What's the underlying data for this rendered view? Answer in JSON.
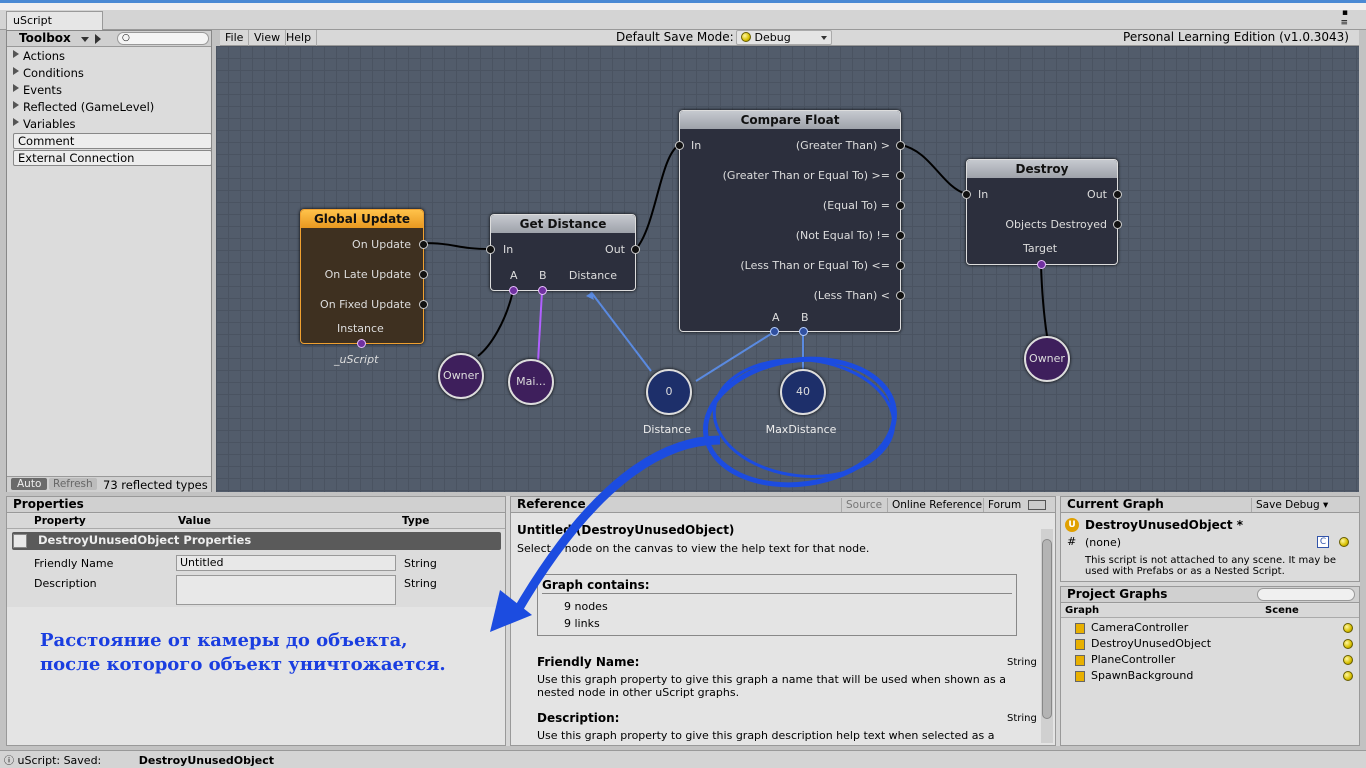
{
  "window": {
    "tab_title": "uScript"
  },
  "toolbox": {
    "title": "Toolbox",
    "tree": [
      "Actions",
      "Conditions",
      "Events",
      "Reflected (GameLevel)",
      "Variables"
    ],
    "buttons": [
      "Comment",
      "External Connection"
    ],
    "footer": {
      "auto": "Auto",
      "refresh": "Refresh",
      "count": "73 reflected types"
    }
  },
  "menubar": {
    "items": [
      "File",
      "View",
      "Help"
    ],
    "save_mode_label": "Default Save Mode:",
    "save_mode_value": "Debug",
    "edition": "Personal Learning Edition (v1.0.3043)"
  },
  "nodes": {
    "global_update": {
      "title": "Global Update",
      "outputs": [
        "On Update",
        "On Late Update",
        "On Fixed Update"
      ],
      "bottom": "Instance",
      "caption": "_uScript"
    },
    "get_distance": {
      "title": "Get Distance",
      "in": "In",
      "out": "Out",
      "a": "A",
      "b": "B",
      "distance": "Distance"
    },
    "compare_float": {
      "title": "Compare Float",
      "in": "In",
      "outputs": [
        "(Greater Than)  >",
        "(Greater Than or Equal To) >=",
        "(Equal To)   =",
        "(Not Equal To)  !=",
        "(Less Than or Equal To) <=",
        "(Less Than)   <"
      ],
      "a": "A",
      "b": "B"
    },
    "destroy": {
      "title": "Destroy",
      "in": "In",
      "out": "Out",
      "objects_destroyed": "Objects Destroyed",
      "target": "Target"
    }
  },
  "variables": {
    "owner1": "Owner",
    "main": "Mai...",
    "distance_value": "0",
    "distance_label": "Distance",
    "maxdistance_value": "40",
    "maxdistance_label": "MaxDistance",
    "owner2": "Owner"
  },
  "properties": {
    "title": "Properties",
    "columns": [
      "Property",
      "Value",
      "Type"
    ],
    "group": "DestroyUnusedObject Properties",
    "rows": [
      {
        "property": "Friendly Name",
        "value": "Untitled",
        "type": "String"
      },
      {
        "property": "Description",
        "value": "",
        "type": "String"
      }
    ]
  },
  "annotation": {
    "line1": "Расстояние от камеры до объекта,",
    "line2": "после которого объект уничтожается."
  },
  "reference": {
    "title": "Reference",
    "tabs": [
      "Source",
      "Online Reference",
      "Forum"
    ],
    "heading": "Untitled (DestroyUnusedObject)",
    "hint": "Select a node on the canvas to view the help text for that node.",
    "graph_contains": "Graph contains:",
    "nodes": "9 nodes",
    "links": "9 links",
    "friendly_name_label": "Friendly Name:",
    "friendly_name_type": "String",
    "friendly_name_text": "Use this graph property to give this graph a name that will be used when shown as a nested node in other uScript graphs.",
    "description_label": "Description:",
    "description_type": "String",
    "description_text": "Use this graph property to give this graph description help text when selected as a"
  },
  "current_graph": {
    "title": "Current Graph",
    "save_btn": "Save Debug",
    "name": "DestroyUnusedObject *",
    "none": "(none)",
    "note": "This script is not attached to any scene. It may be used with Prefabs or as a Nested Script."
  },
  "project_graphs": {
    "title": "Project Graphs",
    "columns": [
      "Graph",
      "Scene"
    ],
    "items": [
      "CameraController",
      "DestroyUnusedObject",
      "PlaneController",
      "SpawnBackground"
    ]
  },
  "status": {
    "label": "uScript: Saved:",
    "file": "DestroyUnusedObject"
  }
}
